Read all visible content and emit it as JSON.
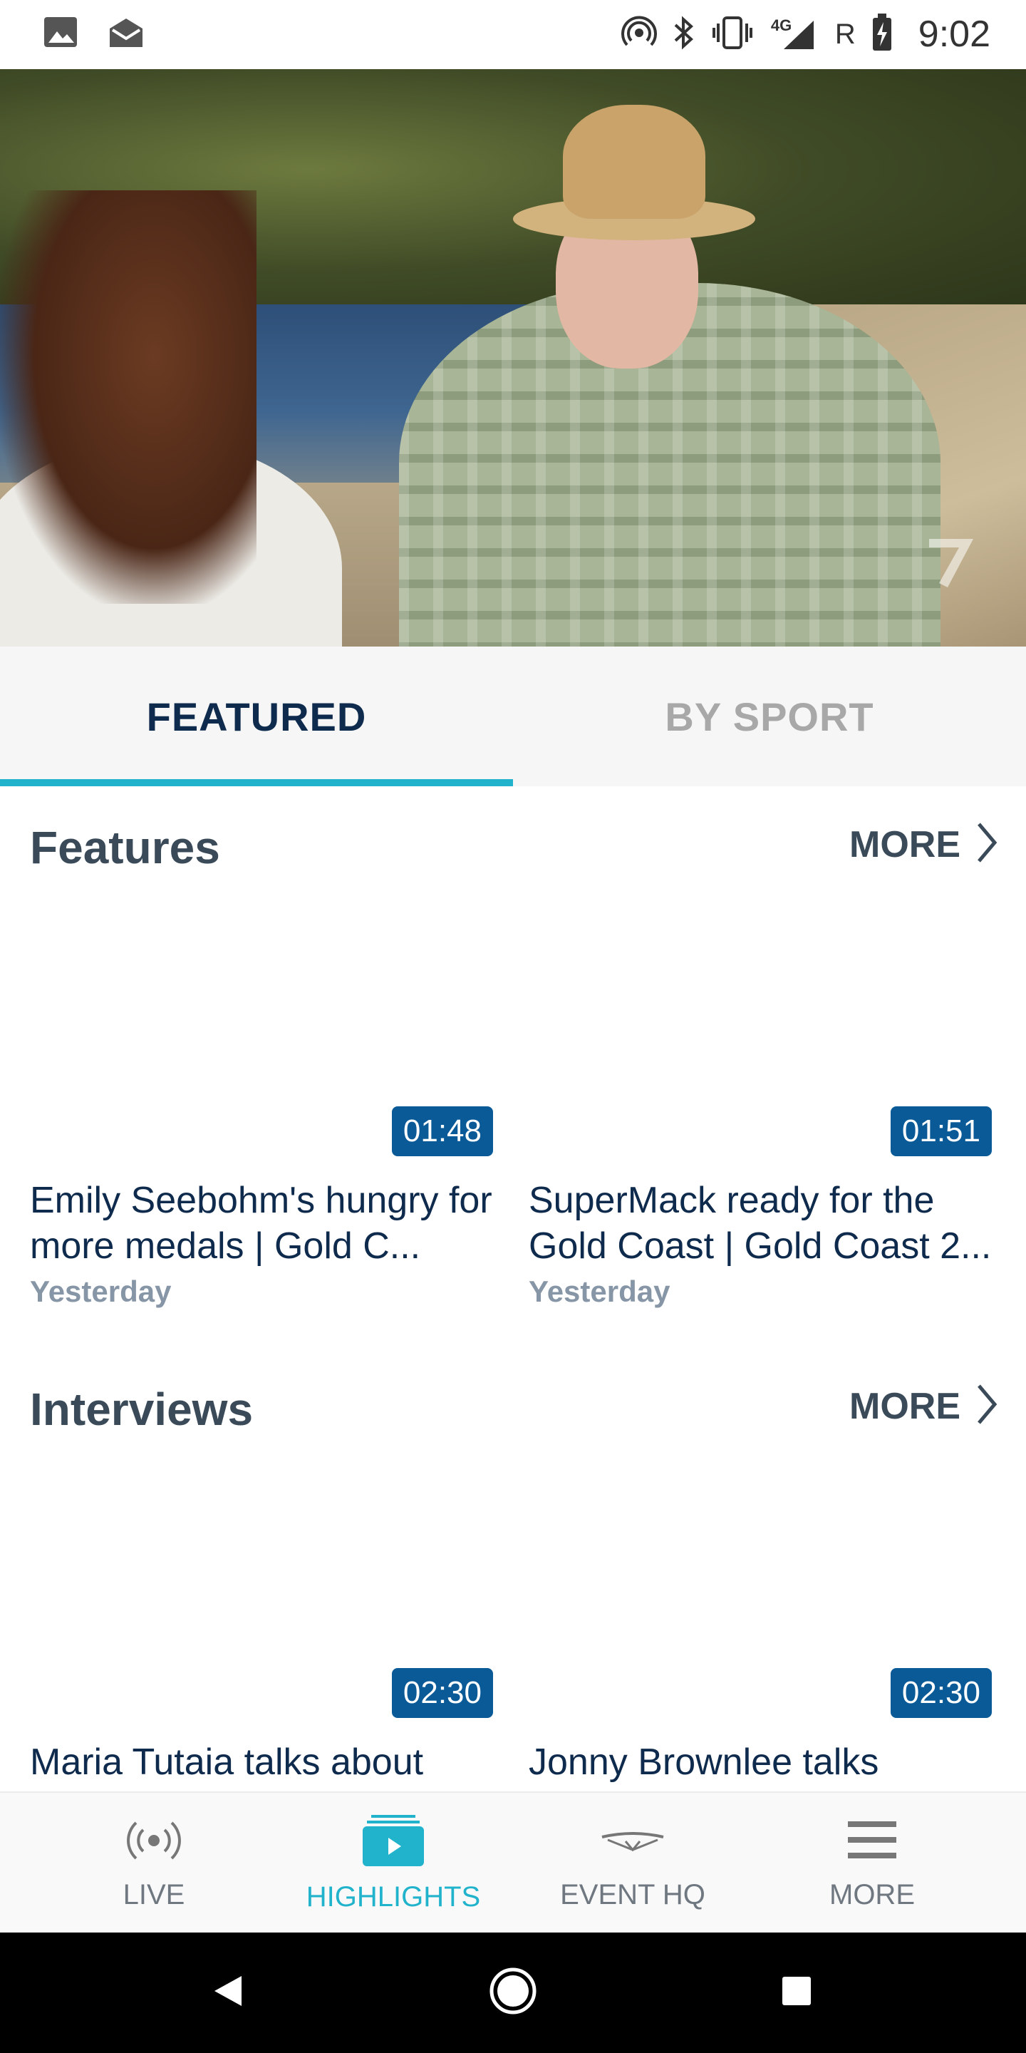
{
  "status_bar": {
    "time": "9:02",
    "network": "4G",
    "roaming": "R",
    "left_icons": [
      "image-icon",
      "mail-icon"
    ],
    "right_icons": [
      "hotspot-icon",
      "bluetooth-icon",
      "vibrate-icon",
      "signal-icon",
      "battery-charging-icon"
    ]
  },
  "hero": {
    "watermark_icon": "channel-7-logo"
  },
  "tabs": [
    {
      "label": "FEATURED",
      "active": true
    },
    {
      "label": "BY SPORT",
      "active": false
    }
  ],
  "sections": [
    {
      "title": "Features",
      "more_label": "MORE",
      "cards": [
        {
          "duration": "01:48",
          "title": "Emily Seebohm's hungry for more medals | Gold C...",
          "date": "Yesterday"
        },
        {
          "duration": "01:51",
          "title": "SuperMack ready for the Gold Coast | Gold Coast 2...",
          "date": "Yesterday"
        }
      ]
    },
    {
      "title": "Interviews",
      "more_label": "MORE",
      "cards": [
        {
          "duration": "02:30",
          "title": "Maria Tutaia talks about"
        },
        {
          "duration": "02:30",
          "title": "Jonny Brownlee talks"
        }
      ]
    }
  ],
  "bottom_nav": [
    {
      "label": "LIVE",
      "icon": "broadcast-icon",
      "active": false
    },
    {
      "label": "HIGHLIGHTS",
      "icon": "video-play-icon",
      "active": true
    },
    {
      "label": "EVENT HQ",
      "icon": "event-logo-icon",
      "active": false
    },
    {
      "label": "MORE",
      "icon": "menu-icon",
      "active": false
    }
  ],
  "colors": {
    "accent": "#21b3cc",
    "navy": "#0e2a4c",
    "badge": "#0a5a98",
    "section_title": "#3a4a58",
    "date": "#8796a6"
  }
}
